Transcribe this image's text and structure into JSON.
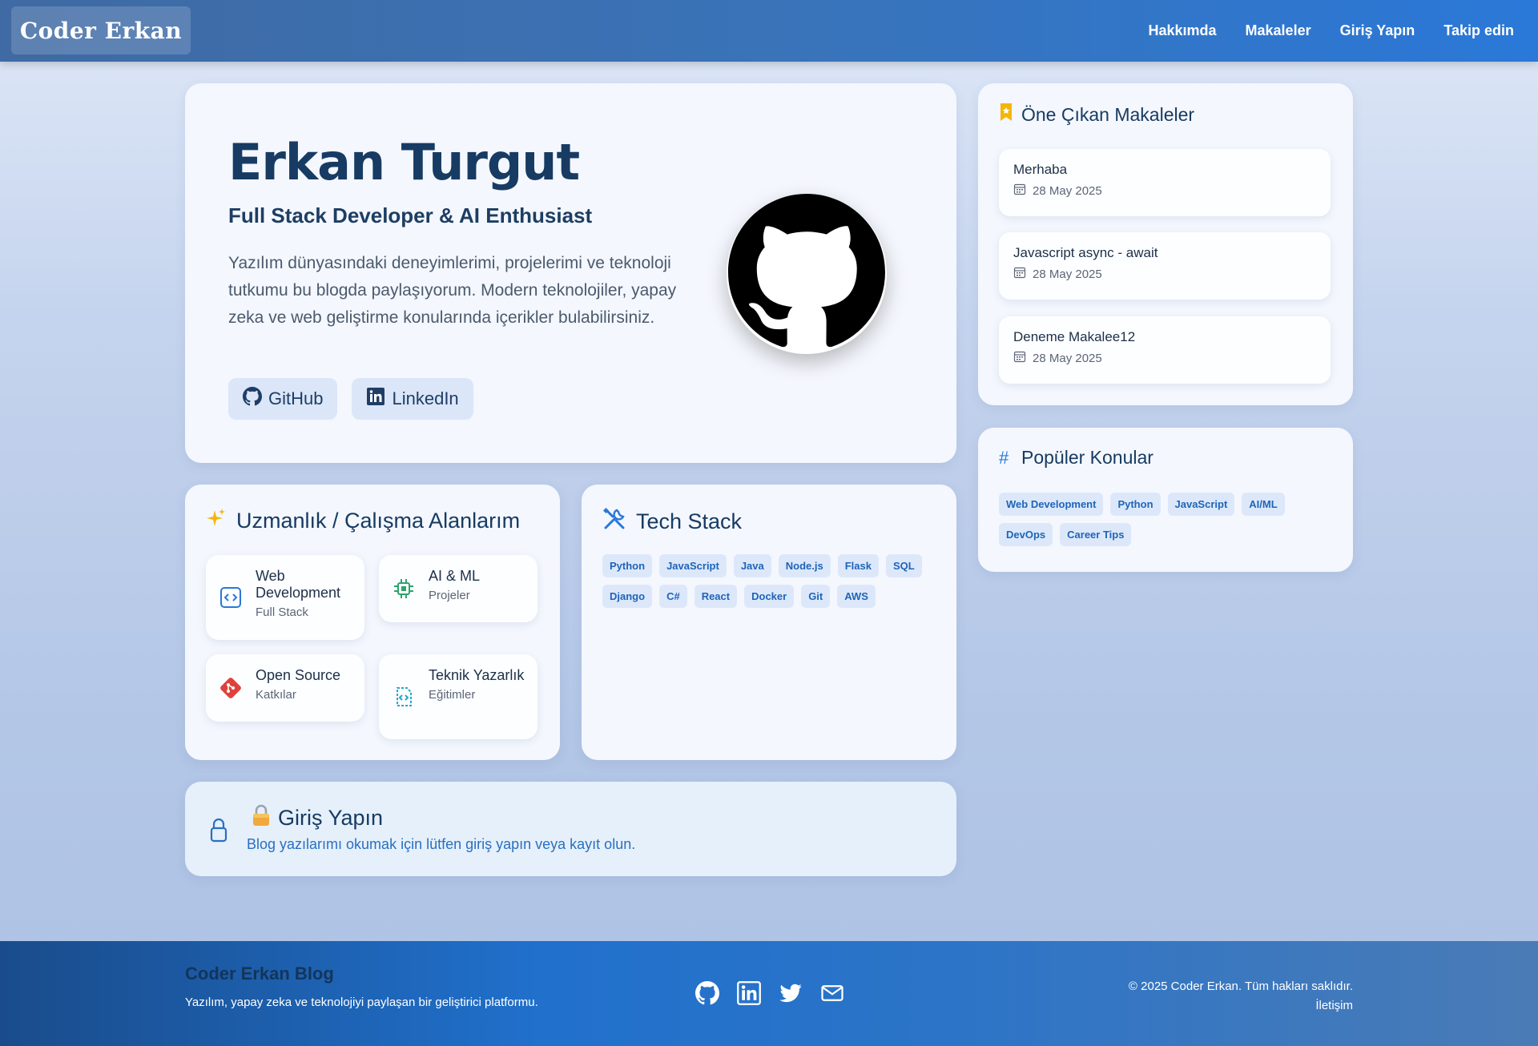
{
  "navbar": {
    "brand": "Coder Erkan",
    "links": [
      "Hakkımda",
      "Makaleler",
      "Giriş Yapın",
      "Takip edin"
    ]
  },
  "hero": {
    "name": "Erkan Turgut",
    "subtitle": "Full Stack Developer & AI Enthusiast",
    "description": "Yazılım dünyasındaki deneyimlerimi, projelerimi ve teknoloji tutkumu bu blogda paylaşıyorum. Modern teknolojiler, yapay zeka ve web geliştirme konularında içerikler bulabilirsiniz.",
    "github_label": "GitHub",
    "linkedin_label": "LinkedIn",
    "avatar_icon": "github-octocat-icon"
  },
  "featured": {
    "title": "Öne Çıkan Makaleler",
    "articles": [
      {
        "title": "Merhaba",
        "date": "28 May 2025"
      },
      {
        "title": "Javascript async - await",
        "date": "28 May 2025"
      },
      {
        "title": "Deneme Makalee12",
        "date": "28 May 2025"
      }
    ]
  },
  "popular": {
    "title": "Popüler Konular",
    "tags": [
      "Web Development",
      "Python",
      "JavaScript",
      "AI/ML",
      "DevOps",
      "Career Tips"
    ]
  },
  "expertise": {
    "title": "Uzmanlık / Çalışma Alanlarım",
    "items": [
      {
        "name": "Web Development",
        "sub": "Full Stack"
      },
      {
        "name": "AI & ML",
        "sub": "Projeler"
      },
      {
        "name": "Open Source",
        "sub": "Katkılar"
      },
      {
        "name": "Teknik Yazarlık",
        "sub": "Eğitimler"
      }
    ]
  },
  "tech": {
    "title": "Tech Stack",
    "tags": [
      "Python",
      "JavaScript",
      "Java",
      "Node.js",
      "Flask",
      "SQL",
      "Django",
      "C#",
      "React",
      "Docker",
      "Git",
      "AWS"
    ]
  },
  "login": {
    "title": "Giriş Yapın",
    "subtitle": "Blog yazılarımı okumak için lütfen giriş yapın veya kayıt olun."
  },
  "footer": {
    "title": "Coder Erkan Blog",
    "subtitle": "Yazılım, yapay zeka ve teknolojiyi paylaşan bir geliştirici platformu.",
    "copyright": "© 2025 Coder Erkan. Tüm hakları saklıdır.",
    "contact": "İletişim"
  },
  "colors": {
    "accent": "#2a78d8",
    "heading": "#173b63",
    "tag_bg": "#dce8fa",
    "tag_text": "#1f64b8"
  }
}
